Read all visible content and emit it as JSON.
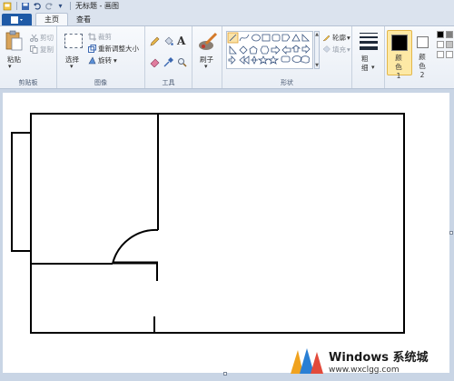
{
  "window": {
    "title": "无标题 - 画图"
  },
  "tabs": {
    "file_label": "▮▾",
    "home": "主页",
    "view": "查看"
  },
  "ribbon": {
    "clipboard": {
      "paste": "粘贴",
      "cut": "剪切",
      "copy": "复制",
      "group": "剪贴板"
    },
    "image": {
      "select": "选择",
      "crop": "裁剪",
      "resize": "重新调整大小",
      "rotate": "旋转",
      "group": "图像"
    },
    "tools": {
      "text_tool": "A",
      "group": "工具"
    },
    "brushes": {
      "label": "刷子"
    },
    "shapes": {
      "outline": "轮廓",
      "fill": "填充",
      "group": "形状"
    },
    "size": {
      "label": "粗细"
    },
    "colors": {
      "color1": "颜色 1",
      "color2": "颜色 2",
      "color1_hex": "#000000",
      "color2_hex": "#ffffff"
    }
  },
  "watermark": {
    "title": "Windows 系统城",
    "url": "www.wxclgg.com"
  },
  "colors": {
    "accent": "#1f5aa6",
    "ribbon_bg": "#f3f6fa",
    "workspace_bg": "#c9d5e5"
  }
}
